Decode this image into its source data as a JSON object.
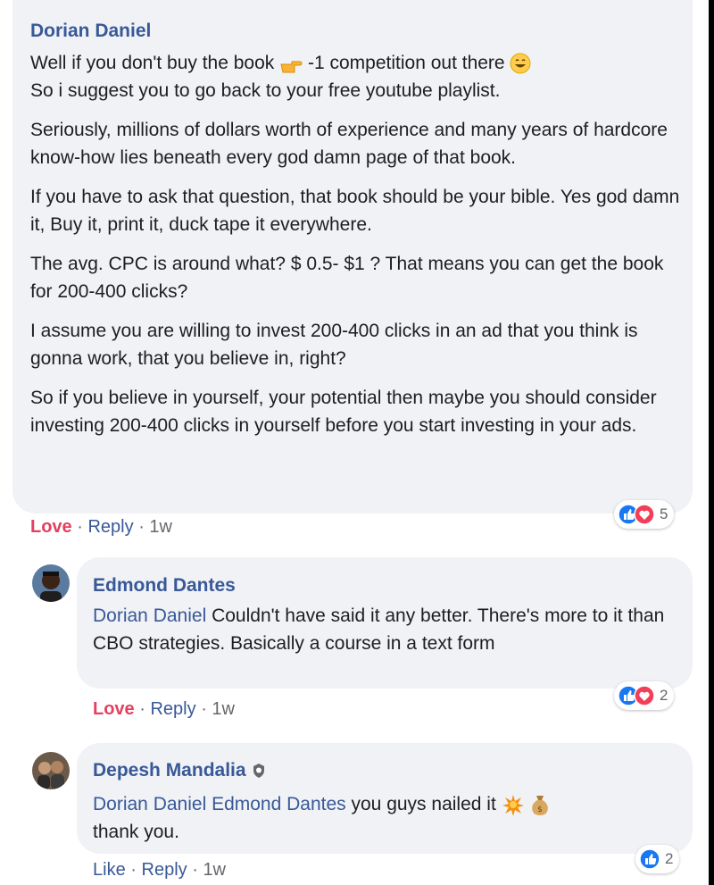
{
  "comment1": {
    "author": "Dorian Daniel",
    "line1_a": "Well if you don't buy the book",
    "line1_b": "-1 competition out there",
    "line2": "So i suggest you to go back to your free youtube playlist.",
    "p2": "Seriously, millions of dollars worth of experience and many years of hardcore know-how lies beneath every god damn page of that book.",
    "p3": "If you have to ask that question, that book should be your bible. Yes god damn it, Buy it, print it, duck tape it everywhere.",
    "p4": "The avg. CPC is around what? $ 0.5- $1 ? That means you can get the book for 200-400 clicks?",
    "p5": "I assume you are willing to invest 200-400 clicks in an ad that you think is gonna work, that you believe in, right?",
    "p6": "So if you believe in yourself, your potential then maybe you should consider investing 200-400 clicks in yourself before you start investing in your ads.",
    "love_label": "Love",
    "reply_label": "Reply",
    "time": "1w",
    "reaction_count": "5"
  },
  "reply1": {
    "author": "Edmond Dantes",
    "mention": "Dorian Daniel",
    "text": " Couldn't have said it any better. There's more to it than CBO strategies. Basically a course in a text form",
    "love_label": "Love",
    "reply_label": "Reply",
    "time": "1w",
    "reaction_count": "2"
  },
  "reply2": {
    "author": "Depesh Mandalia",
    "mention1": "Dorian Daniel",
    "mention2": "Edmond Dantes",
    "text": " you guys nailed it",
    "text2": "thank you.",
    "like_label": "Like",
    "reply_label": "Reply",
    "time": "1w",
    "reaction_count": "2"
  },
  "separator": "·",
  "colors": {
    "link": "#385898",
    "love": "#e4405f",
    "bubble": "#f0f2f5",
    "like_blue": "#1877f2"
  }
}
